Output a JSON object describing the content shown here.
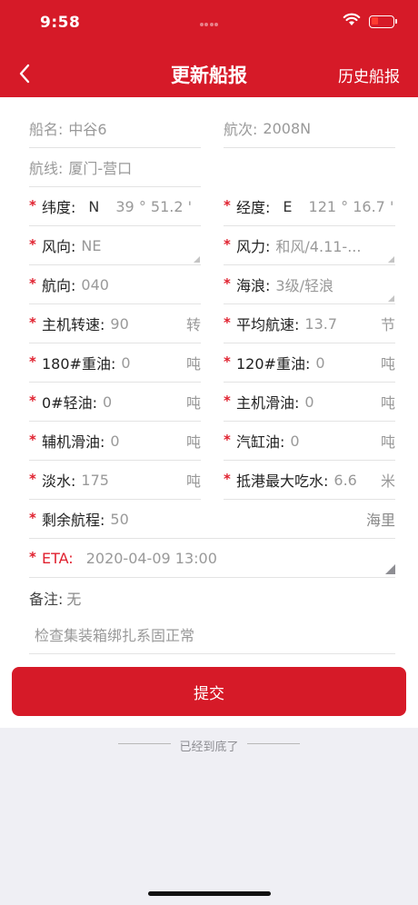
{
  "status_bar": {
    "time": "9:58"
  },
  "nav": {
    "title": "更新船报",
    "right_label": "历史船报"
  },
  "form": {
    "ship_name": {
      "label": "船名:",
      "value": "中谷6"
    },
    "voyage": {
      "label": "航次:",
      "value": "2008N"
    },
    "route": {
      "label": "航线:",
      "value": "厦门-营口"
    },
    "latitude": {
      "label": "纬度:",
      "direction": "N",
      "value": "39 ° 51.2 '"
    },
    "longitude": {
      "label": "经度:",
      "direction": "E",
      "value": "121 ° 16.7 '"
    },
    "wind_direction": {
      "label": "风向:",
      "value": "NE"
    },
    "wind_force": {
      "label": "风力:",
      "value": "和风/4.11-..."
    },
    "heading": {
      "label": "航向:",
      "value": "040"
    },
    "waves": {
      "label": "海浪:",
      "value": "3级/轻浪"
    },
    "engine_rpm": {
      "label": "主机转速:",
      "value": "90",
      "unit": "转"
    },
    "avg_speed": {
      "label": "平均航速:",
      "value": "13.7",
      "unit": "节"
    },
    "heavy_oil_180": {
      "label": "180#重油:",
      "value": "0",
      "unit": "吨"
    },
    "heavy_oil_120": {
      "label": "120#重油:",
      "value": "0",
      "unit": "吨"
    },
    "light_oil_0": {
      "label": "0#轻油:",
      "value": "0",
      "unit": "吨"
    },
    "main_lube": {
      "label": "主机滑油:",
      "value": "0",
      "unit": "吨"
    },
    "aux_lube": {
      "label": "辅机滑油:",
      "value": "0",
      "unit": "吨"
    },
    "cylinder_oil": {
      "label": "汽缸油:",
      "value": "0",
      "unit": "吨"
    },
    "fresh_water": {
      "label": "淡水:",
      "value": "175",
      "unit": "吨"
    },
    "max_draft": {
      "label": "抵港最大吃水:",
      "value": "6.6",
      "unit": "米"
    },
    "remaining_distance": {
      "label": "剩余航程:",
      "value": "50",
      "unit": "海里"
    },
    "eta": {
      "label": "ETA:",
      "value": "2020-04-09 13:00"
    },
    "remark": {
      "label": "备注:",
      "value": "无"
    },
    "note_text": "检查集装箱绑扎系固正常",
    "required_mark": "*"
  },
  "submit_label": "提交",
  "footer_text": "已经到底了",
  "colors": {
    "brand_red": "#d61a28",
    "required_red": "#e0202e"
  }
}
